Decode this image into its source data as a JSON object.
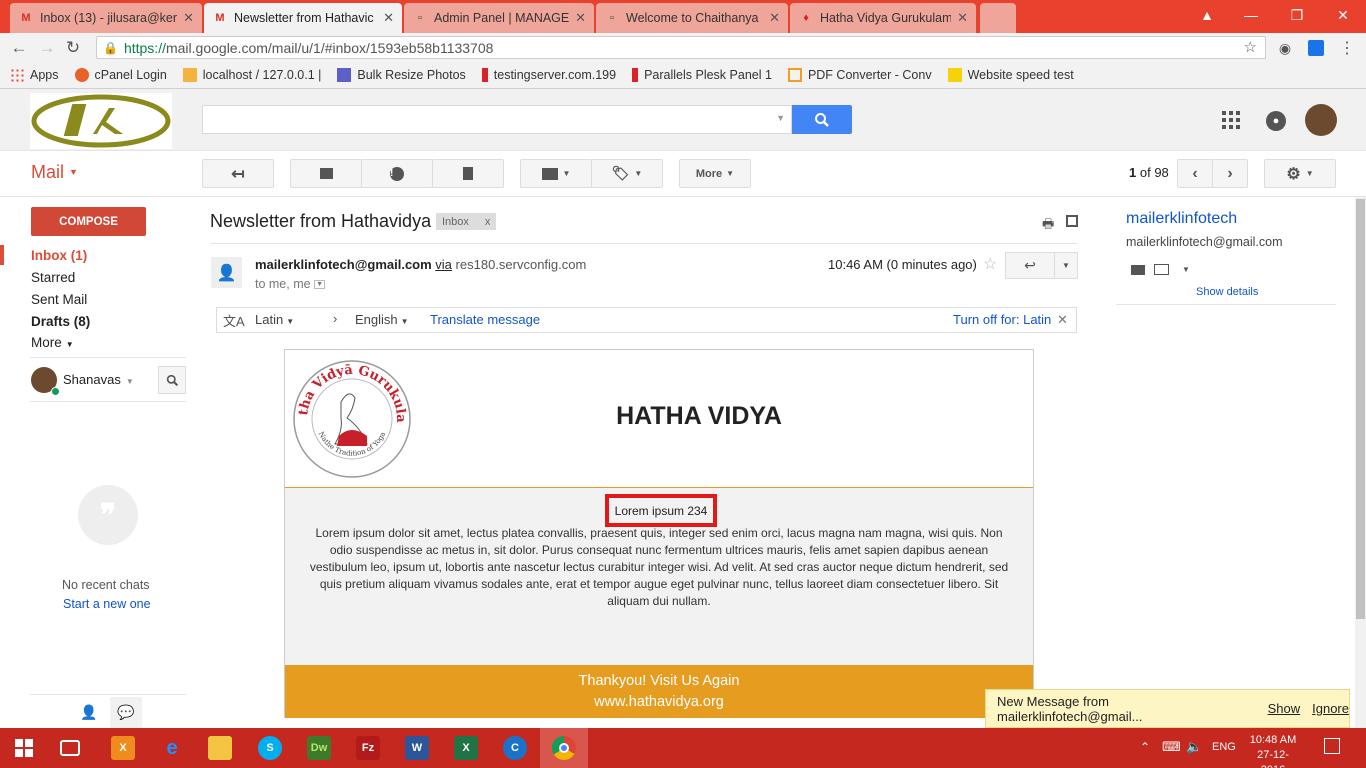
{
  "browser": {
    "tabs": [
      {
        "label": "Inbox (13) - jilusara@ker",
        "icon": "gmail-icon"
      },
      {
        "label": "Newsletter from Hathavic",
        "icon": "gmail-icon",
        "active": true
      },
      {
        "label": "Admin Panel | MANAGE",
        "icon": "doc-icon"
      },
      {
        "label": "Welcome to Chaithanya",
        "icon": "doc-icon"
      },
      {
        "label": "Hatha Vidya Gurukulam",
        "icon": "flame-icon"
      }
    ],
    "url_https": "https://",
    "url_rest": "mail.google.com/mail/u/1/#inbox/1593eb58b1133708",
    "bookmarks": [
      {
        "label": "Apps",
        "color": "#e04a3f"
      },
      {
        "label": "cPanel Login",
        "color": "#e8622a"
      },
      {
        "label": "localhost / 127.0.0.1 |",
        "color": "#f3b33d"
      },
      {
        "label": "Bulk Resize Photos",
        "color": "#5b5fc7"
      },
      {
        "label": "testingserver.com.199",
        "color": "#d9222a"
      },
      {
        "label": "Parallels Plesk Panel 1",
        "color": "#d9222a"
      },
      {
        "label": "PDF Converter - Conv",
        "color": "#f0a020"
      },
      {
        "label": "Website speed test",
        "color": "#f5d20a"
      }
    ]
  },
  "gmail": {
    "mail_label": "Mail",
    "toolbar": {
      "more_label": "More",
      "pagination_current": "1",
      "pagination_rest": "of 98"
    },
    "compose_label": "COMPOSE",
    "nav": [
      {
        "label": "Inbox (1)",
        "bold": true,
        "active": true
      },
      {
        "label": "Starred"
      },
      {
        "label": "Sent Mail"
      },
      {
        "label": "Drafts (8)",
        "bold": true
      },
      {
        "label": "More"
      }
    ],
    "hangouts": {
      "user_name": "Shanavas",
      "no_chats": "No recent chats",
      "start_new": "Start a new one"
    },
    "message": {
      "subject": "Newsletter from Hathavidya",
      "label_chip": "Inbox",
      "label_chip_close": "x",
      "sender_email": "mailerklinfotech@gmail.com",
      "via_label": "via",
      "via_server": "res180.servconfig.com",
      "recipients": "to me, me",
      "time": "10:46 AM (0 minutes ago)"
    },
    "translate": {
      "source_lang": "Latin",
      "target_lang": "English",
      "translate_link": "Translate message",
      "turn_off": "Turn off for: Latin"
    },
    "newsletter": {
      "logo_text_top": "Hatha Vidyā Gurukulam",
      "logo_text_bottom": "Nathe Tradition of Yoga",
      "title": "HATHA VIDYA",
      "highlight": "Lorem ipsum 234",
      "body": "Lorem ipsum dolor sit amet, lectus platea convallis, praesent quis, integer sed enim orci, lacus magna nam magna, wisi quis. Non odio suspendisse ac metus in, sit dolor. Purus consequat nunc fermentum ultrices mauris, felis amet sapien dapibus aenean vestibulum leo, ipsum ut, lobortis ante nascetur lectus curabitur integer wisi. Ad velit. At sed cras auctor neque dictum hendrerit, sed quis pretium aliquam vivamus sodales ante, erat et tempor augue eget pulvinar nunc, tellus laoreet diam consectetuer libero. Sit aliquam dui nullam.",
      "footer_line1": "Thankyou! Visit Us Again",
      "footer_line2": "www.hathavidya.org"
    },
    "sidebar": {
      "contact_name": "mailerklinfotech",
      "contact_email": "mailerklinfotech@gmail.com",
      "show_details": "Show details"
    },
    "notification": {
      "text": "New Message from mailerklinfotech@gmail...",
      "show": "Show",
      "ignore": "Ignore"
    }
  },
  "taskbar": {
    "lang": "ENG",
    "time": "10:48 AM",
    "date": "27-12-2016"
  },
  "colors": {
    "tabbar": "#e8412e",
    "taskbar": "#c4281e",
    "gmail_red": "#dd4b39",
    "newsletter_orange": "#e69c1f",
    "search_blue": "#4285f4"
  }
}
